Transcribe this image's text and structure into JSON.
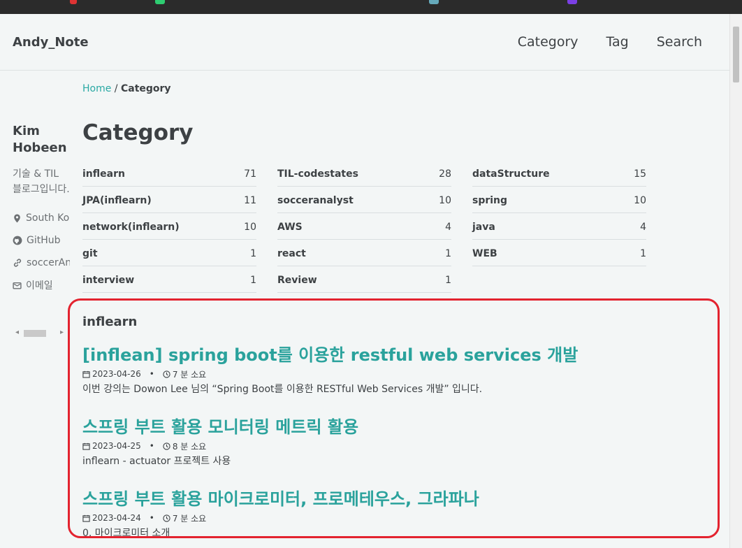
{
  "site": {
    "title": "Andy_Note"
  },
  "nav": {
    "items": [
      "Category",
      "Tag",
      "Search"
    ]
  },
  "breadcrumb": {
    "home": "Home",
    "sep": "/",
    "current": "Category"
  },
  "author": {
    "name": "Kim Hobeen",
    "bio": "기술 & TIL 블로그입니다.",
    "links": [
      {
        "icon": "location-icon",
        "label": "South Korea"
      },
      {
        "icon": "github-icon",
        "label": "GitHub"
      },
      {
        "icon": "link-icon",
        "label": "soccerAnalyst"
      },
      {
        "icon": "mail-icon",
        "label": "이메일"
      }
    ]
  },
  "page": {
    "title": "Category"
  },
  "categories": [
    {
      "name": "inflearn",
      "count": "71"
    },
    {
      "name": "TIL-codestates",
      "count": "28"
    },
    {
      "name": "dataStructure",
      "count": "15"
    },
    {
      "name": "JPA(inflearn)",
      "count": "11"
    },
    {
      "name": "socceranalyst",
      "count": "10"
    },
    {
      "name": "spring",
      "count": "10"
    },
    {
      "name": "network(inflearn)",
      "count": "10"
    },
    {
      "name": "AWS",
      "count": "4"
    },
    {
      "name": "java",
      "count": "4"
    },
    {
      "name": "git",
      "count": "1"
    },
    {
      "name": "react",
      "count": "1"
    },
    {
      "name": "WEB",
      "count": "1"
    },
    {
      "name": "interview",
      "count": "1"
    },
    {
      "name": "Review",
      "count": "1"
    }
  ],
  "section": {
    "title": "inflearn"
  },
  "posts": [
    {
      "title": "[inflean] spring boot를 이용한 restful web services 개발",
      "date": "2023-04-26",
      "read": "7 분 소요",
      "excerpt": "이번 강의는 Dowon Lee 님의 “Spring Boot를 이용한 RESTful Web Services 개발” 입니다."
    },
    {
      "title": "스프링 부트 활용 모니터링 메트릭 활용",
      "date": "2023-04-25",
      "read": "8 분 소요",
      "excerpt": "inflearn - actuator 프로젝트 사용"
    },
    {
      "title": "스프링 부트 활용 마이크로미터, 프로메테우스, 그라파나",
      "date": "2023-04-24",
      "read": "7 분 소요",
      "excerpt": "0. 마이크로미터 소개"
    }
  ],
  "colors": {
    "accent": "#2aa29c",
    "highlight": "#e3232f",
    "background": "#f3f6f6",
    "text": "#3d4144"
  }
}
